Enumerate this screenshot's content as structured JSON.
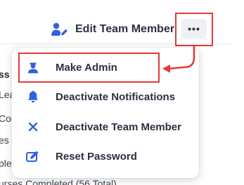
{
  "background": {
    "lines": [
      {
        "text": "ss",
        "bold": true
      },
      {
        "text": "Lea",
        "bold": false
      },
      {
        "text": "Cor",
        "bold": false
      },
      {
        "text": "es",
        "bold": false
      },
      {
        "text": "ple",
        "bold": false
      }
    ],
    "footer_text": "urses Completed (56 Total)"
  },
  "header": {
    "edit_member_label": "Edit Team Member",
    "more_label": "•••"
  },
  "menu": {
    "items": [
      {
        "label": "Make Admin",
        "icon": "admin-user-icon"
      },
      {
        "label": "Deactivate Notifications",
        "icon": "bell-icon"
      },
      {
        "label": "Deactivate Team Member",
        "icon": "close-icon"
      },
      {
        "label": "Reset Password",
        "icon": "edit-password-icon"
      }
    ]
  },
  "colors": {
    "accent": "#2f5fe3",
    "highlight": "#e23a3a",
    "text": "#2b3040"
  }
}
